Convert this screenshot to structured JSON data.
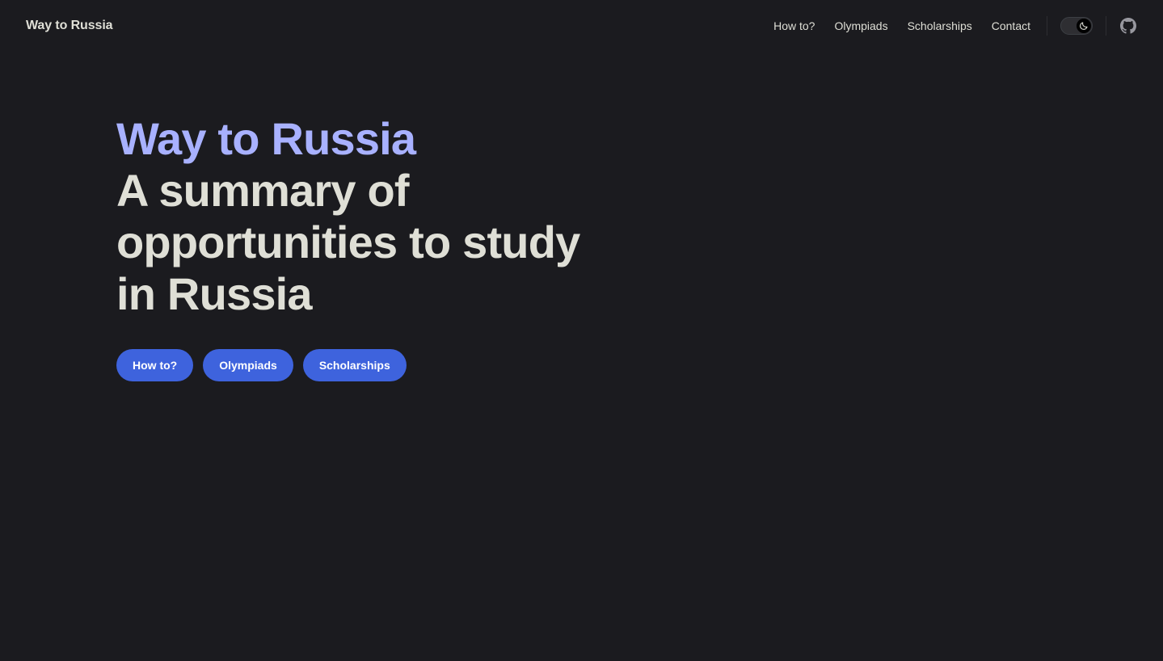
{
  "nav": {
    "site_title": "Way to Russia",
    "links": [
      {
        "label": "How to?"
      },
      {
        "label": "Olympiads"
      },
      {
        "label": "Scholarships"
      },
      {
        "label": "Contact"
      }
    ],
    "theme_toggle_icon": "moon-icon",
    "social_icon": "github-icon"
  },
  "hero": {
    "name": "Way to Russia",
    "text": "A summary of opportunities to study in Russia",
    "actions": [
      {
        "label": "How to?"
      },
      {
        "label": "Olympiads"
      },
      {
        "label": "Scholarships"
      }
    ]
  },
  "colors": {
    "background": "#1b1b1f",
    "text": "#dfdfd6",
    "brand_name": "#a8b1ff",
    "button_bg": "#3e63dd"
  }
}
